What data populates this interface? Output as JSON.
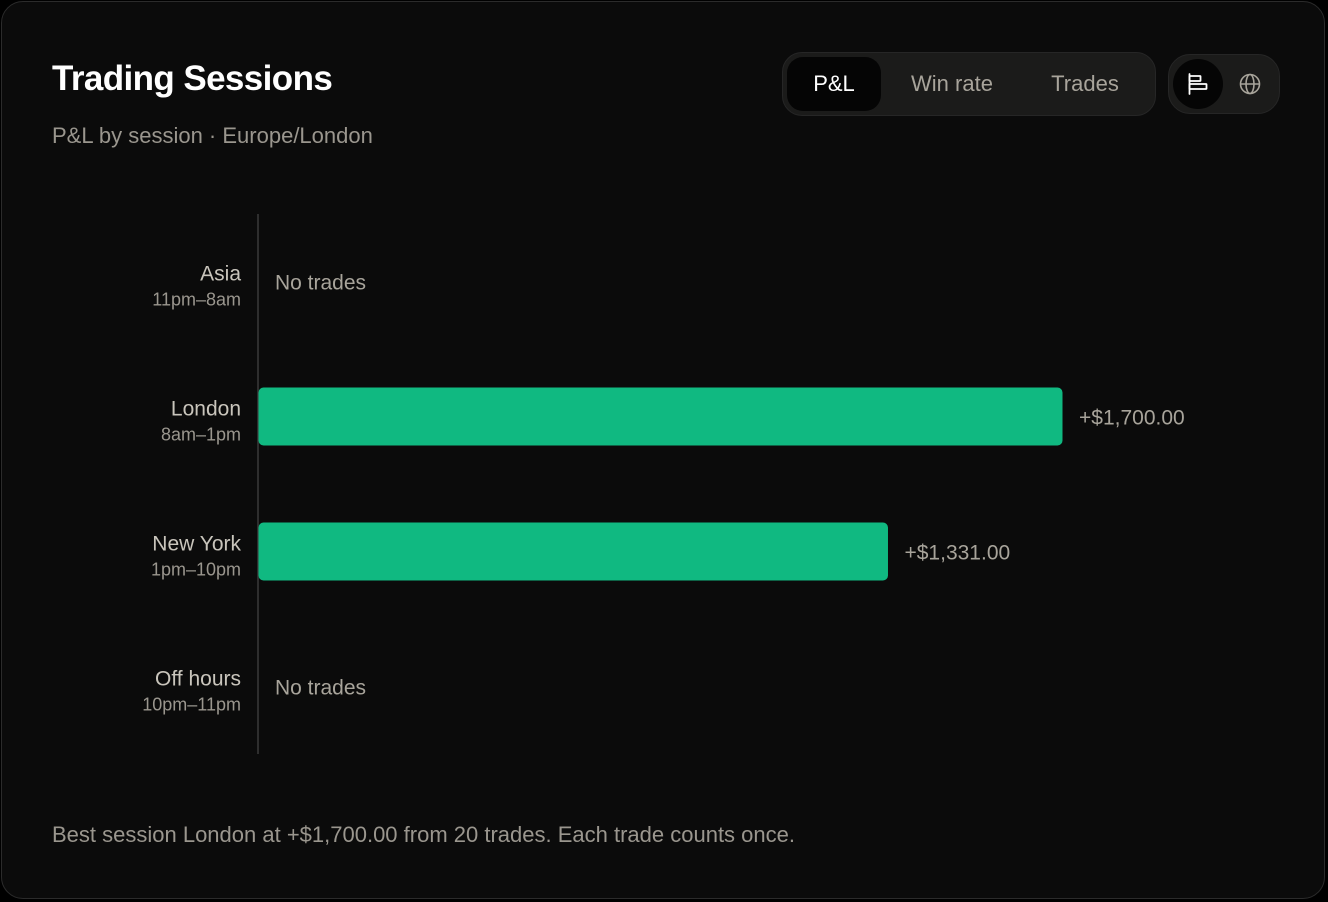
{
  "header": {
    "title": "Trading Sessions",
    "subtitle": "P&L by session · Europe/London"
  },
  "metric_tabs": [
    {
      "label": "P&L",
      "active": true
    },
    {
      "label": "Win rate",
      "active": false
    },
    {
      "label": "Trades",
      "active": false
    }
  ],
  "view_toggle": [
    {
      "icon": "bar-chart-icon",
      "active": true
    },
    {
      "icon": "globe-icon",
      "active": false
    }
  ],
  "colors": {
    "bar": "#10b981",
    "axis": "#3a3a3a",
    "muted_text": "#9a968e",
    "label_text": "#c9c5bc",
    "value_text": "#a8a49b"
  },
  "chart_data": {
    "type": "bar",
    "orientation": "horizontal",
    "categories": [
      "Asia",
      "London",
      "New York",
      "Off hours"
    ],
    "category_sublabels": [
      "11pm–8am",
      "8am–1pm",
      "1pm–10pm",
      "10pm–11pm"
    ],
    "values": [
      null,
      1700,
      1331,
      null
    ],
    "value_labels": [
      "No trades",
      "+$1,700.00",
      "+$1,331.00",
      "No trades"
    ],
    "xlim": [
      0,
      1700
    ],
    "grid": false,
    "legend": "none"
  },
  "footer": {
    "summary": "Best session London at +$1,700.00 from 20 trades. Each trade counts once."
  }
}
